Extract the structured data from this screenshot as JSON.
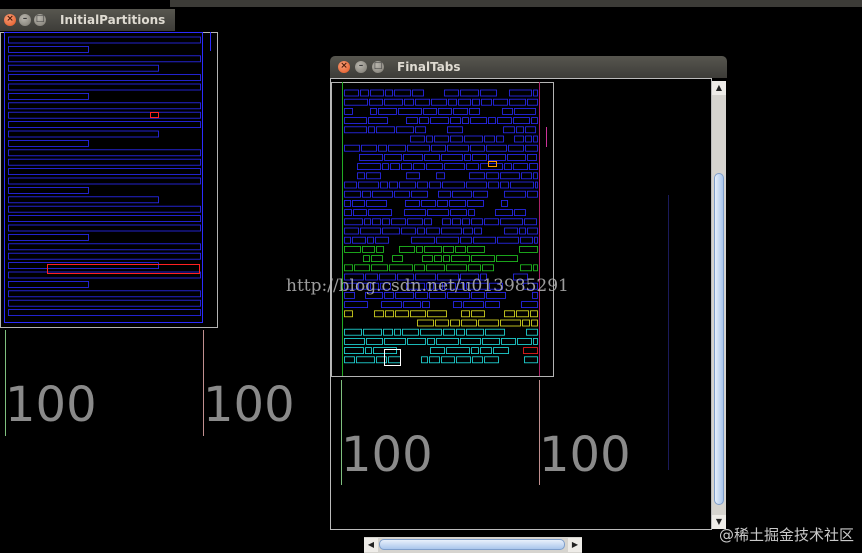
{
  "windows": {
    "initial": {
      "title": "InitialPartitions"
    },
    "final": {
      "title": "FinalTabs"
    }
  },
  "labels": {
    "initial_left": "100",
    "initial_right": "100",
    "final_left": "100",
    "final_right": "100"
  },
  "watermark": "http://blog.csdn.net/u013985291",
  "footer_watermark": "@稀土掘金技术社区",
  "controls": {
    "close": "×",
    "minimize": "–",
    "maximize": "□"
  },
  "colors": {
    "rect_primary": "#2b2bff",
    "rect_highlight": "#ff2020",
    "tab_cyan": "#22e6e6",
    "tab_yellow": "#e6e622",
    "tab_green": "#22cc22",
    "accent_orange": "#ff9900"
  }
}
